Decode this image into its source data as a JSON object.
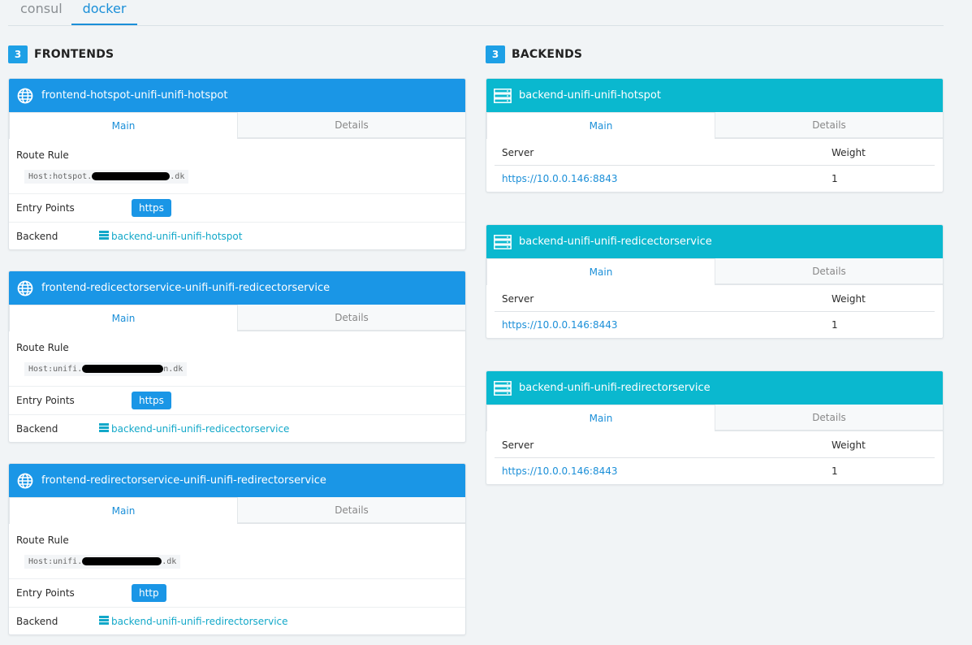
{
  "tabs": [
    {
      "label": "consul"
    },
    {
      "label": "docker"
    }
  ],
  "frontends": {
    "count": "3",
    "title": "FRONTENDS",
    "items": [
      {
        "name": "frontend-hotspot-unifi-unifi-hotspot",
        "tab_main": "Main",
        "tab_details": "Details",
        "route_rule_label": "Route Rule",
        "rule_prefix": "Host:hotspot.",
        "rule_suffix": ".dk",
        "entry_label": "Entry Points",
        "entry": "https",
        "backend_label": "Backend",
        "backend": "backend-unifi-unifi-hotspot"
      },
      {
        "name": "frontend-redicectorservice-unifi-unifi-redicectorservice",
        "tab_main": "Main",
        "tab_details": "Details",
        "route_rule_label": "Route Rule",
        "rule_prefix": "Host:unifi.",
        "rule_suffix": "n.dk",
        "entry_label": "Entry Points",
        "entry": "https",
        "backend_label": "Backend",
        "backend": "backend-unifi-unifi-redicectorservice"
      },
      {
        "name": "frontend-redirectorservice-unifi-unifi-redirectorservice",
        "tab_main": "Main",
        "tab_details": "Details",
        "route_rule_label": "Route Rule",
        "rule_prefix": "Host:unifi.",
        "rule_suffix": ".dk",
        "entry_label": "Entry Points",
        "entry": "http",
        "backend_label": "Backend",
        "backend": "backend-unifi-unifi-redirectorservice"
      }
    ]
  },
  "backends": {
    "count": "3",
    "title": "BACKENDS",
    "items": [
      {
        "name": "backend-unifi-unifi-hotspot",
        "tab_main": "Main",
        "tab_details": "Details",
        "col_server": "Server",
        "col_weight": "Weight",
        "server": "https://10.0.0.146:8843",
        "weight": "1"
      },
      {
        "name": "backend-unifi-unifi-redicectorservice",
        "tab_main": "Main",
        "tab_details": "Details",
        "col_server": "Server",
        "col_weight": "Weight",
        "server": "https://10.0.0.146:8443",
        "weight": "1"
      },
      {
        "name": "backend-unifi-unifi-redirectorservice",
        "tab_main": "Main",
        "tab_details": "Details",
        "col_server": "Server",
        "col_weight": "Weight",
        "server": "https://10.0.0.146:8443",
        "weight": "1"
      }
    ]
  },
  "colors": {
    "frontend_header": "#1a96e6",
    "backend_header": "#0ab8cf",
    "link": "#1b8fd8",
    "backend_link": "#12a8c9"
  },
  "icons": {
    "frontend": "globe-icon",
    "backend": "server-icon"
  }
}
